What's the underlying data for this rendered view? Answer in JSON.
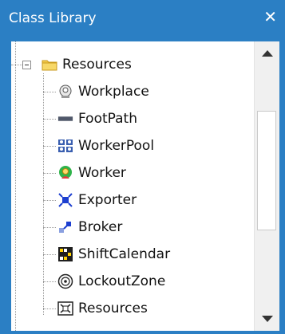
{
  "window": {
    "title": "Class Library",
    "close_glyph": "✕"
  },
  "tree": {
    "root": {
      "label": "Resources",
      "icon": "folder-icon",
      "expanded": true
    },
    "children": [
      {
        "label": "Workplace",
        "icon": "workplace-icon"
      },
      {
        "label": "FootPath",
        "icon": "footpath-icon"
      },
      {
        "label": "WorkerPool",
        "icon": "workerpool-icon"
      },
      {
        "label": "Worker",
        "icon": "worker-icon"
      },
      {
        "label": "Exporter",
        "icon": "exporter-icon"
      },
      {
        "label": "Broker",
        "icon": "broker-icon"
      },
      {
        "label": "ShiftCalendar",
        "icon": "shiftcalendar-icon"
      },
      {
        "label": "LockoutZone",
        "icon": "lockoutzone-icon"
      },
      {
        "label": "Resources",
        "icon": "resources-icon"
      }
    ]
  },
  "colors": {
    "title_bar": "#2b7fc4",
    "folder": "#f2c94c"
  }
}
